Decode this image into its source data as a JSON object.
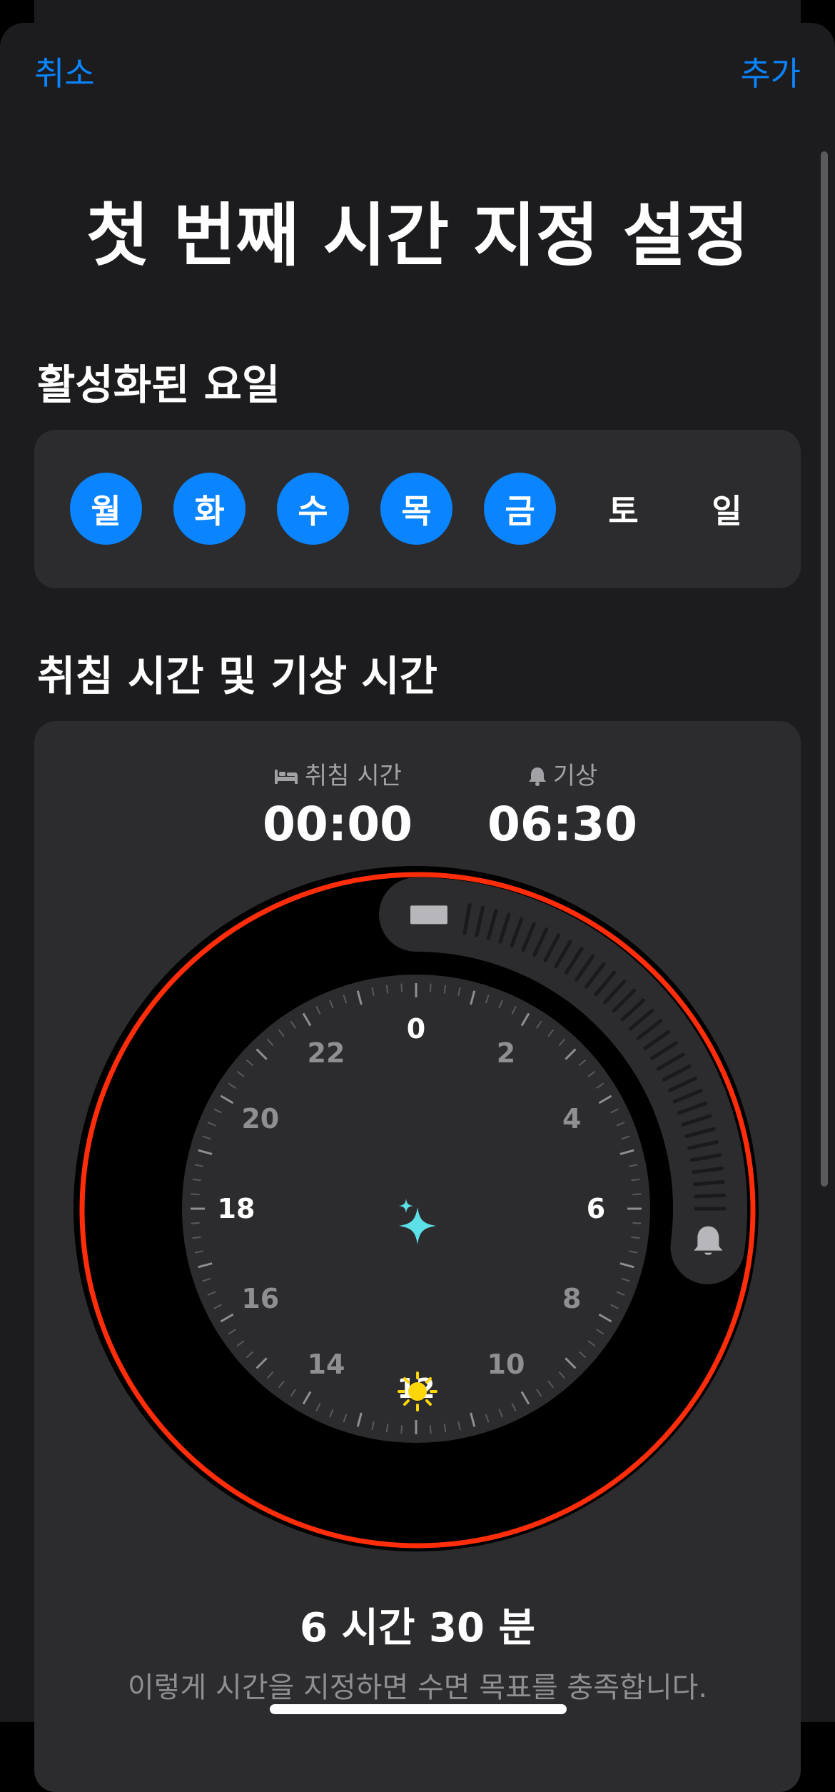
{
  "nav": {
    "cancel_label": "취소",
    "add_label": "추가"
  },
  "title": "첫 번째 시간 지정 설정",
  "active_days": {
    "header": "활성화된 요일",
    "days": [
      {
        "label": "월",
        "active": true
      },
      {
        "label": "화",
        "active": true
      },
      {
        "label": "수",
        "active": true
      },
      {
        "label": "목",
        "active": true
      },
      {
        "label": "금",
        "active": true
      },
      {
        "label": "토",
        "active": false
      },
      {
        "label": "일",
        "active": false
      }
    ]
  },
  "schedule": {
    "header": "취침 시간 및 기상 시간",
    "bedtime": {
      "label": "취침 시간",
      "icon": "bed-icon",
      "value": "00:00"
    },
    "wake": {
      "label": "기상",
      "icon": "bell-icon",
      "value": "06:30"
    },
    "clock_labels": [
      "0",
      "2",
      "4",
      "6",
      "8",
      "10",
      "12",
      "14",
      "16",
      "18",
      "20",
      "22"
    ],
    "duration": "6 시간 30 분",
    "goal_message": "이렇게 시간을 지정하면 수면 목표를 충족합니다."
  },
  "colors": {
    "accent": "#0a84ff",
    "highlight_ring": "#ff2d0a",
    "sparkle": "#5ee0e8",
    "sun": "#ffd60a"
  }
}
